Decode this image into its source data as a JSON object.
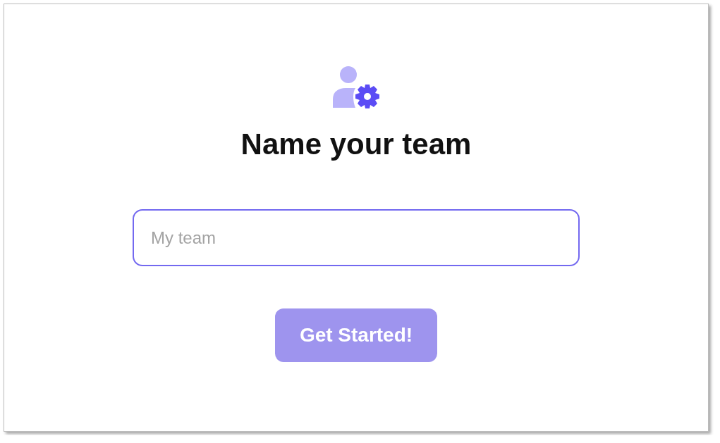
{
  "heading": "Name your team",
  "team_name_field": {
    "placeholder": "My team",
    "focused": true
  },
  "submit_button": {
    "label": "Get Started!",
    "disabled": true
  }
}
